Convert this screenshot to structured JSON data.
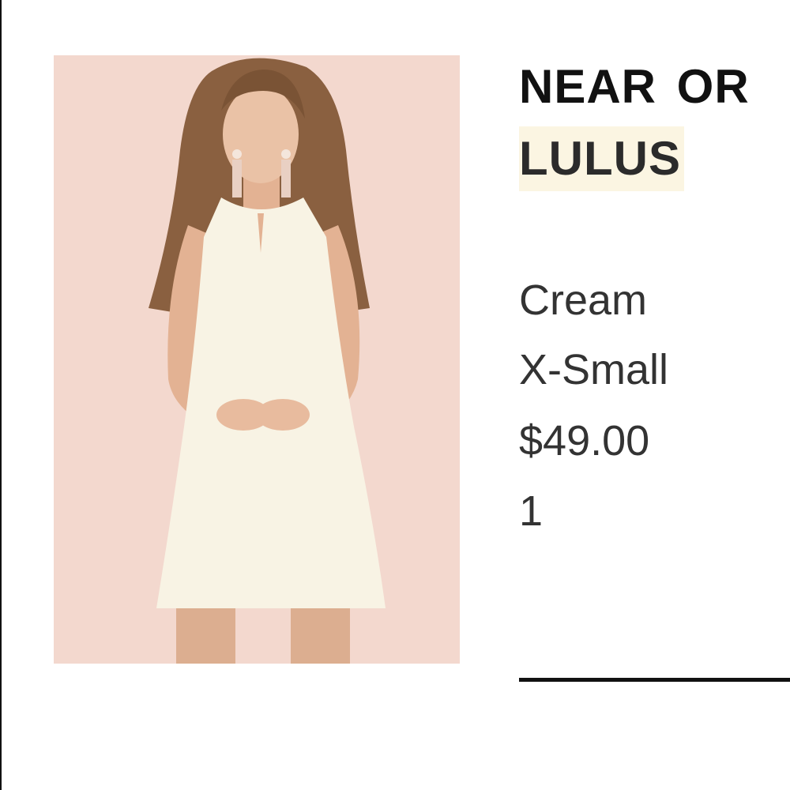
{
  "listing": {
    "title_line_1": "NEAR OR",
    "title_line_2": "LULUS",
    "color": "Cream",
    "size": "X-Small",
    "price": "$49.00",
    "quantity": "1"
  },
  "colors": {
    "image_background": "#f3d8ce",
    "title_highlight": "#fbf5e2",
    "text_dark": "#111111",
    "text_detail": "#333333"
  }
}
